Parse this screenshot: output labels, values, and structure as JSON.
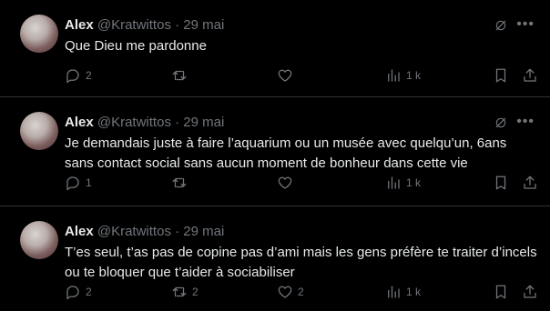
{
  "tweets": [
    {
      "name": "Alex",
      "handle": "@Kratwittos",
      "date": "· 29 mai",
      "text": "Que Dieu me pardonne",
      "replies": "2",
      "retweets": "",
      "likes": "",
      "views": "1 k"
    },
    {
      "name": "Alex",
      "handle": "@Kratwittos",
      "date": "· 29 mai",
      "text": "Je demandais juste à faire l’aquarium ou un musée avec quelqu’un, 6ans sans contact social sans aucun moment de bonheur dans cette vie",
      "replies": "1",
      "retweets": "",
      "likes": "",
      "views": "1 k"
    },
    {
      "name": "Alex",
      "handle": "@Kratwittos",
      "date": "· 29 mai",
      "text": "T’es seul, t’as pas de copine pas d’ami mais les gens préfère te traiter d’incels ou te bloquer que t’aider à sociabiliser",
      "replies": "2",
      "retweets": "2",
      "likes": "2",
      "views": "1 k"
    }
  ],
  "icons": {
    "grok": "grok-icon",
    "more": "more-icon",
    "reply": "reply-icon",
    "retweet": "retweet-icon",
    "like": "like-icon",
    "views": "views-icon",
    "bookmark": "bookmark-icon",
    "share": "share-icon"
  }
}
